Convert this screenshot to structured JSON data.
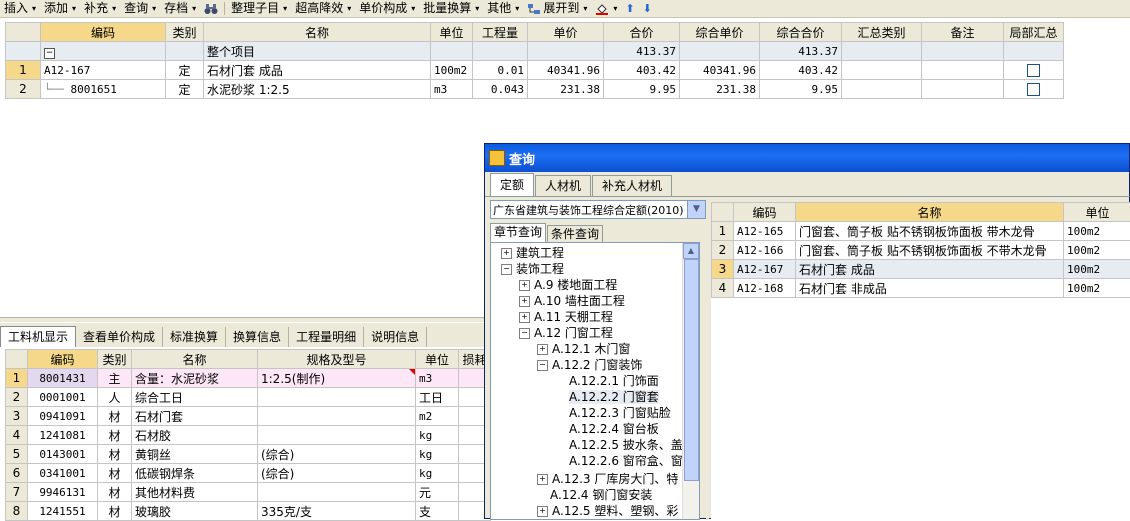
{
  "toolbar": {
    "items": [
      {
        "label": "插入"
      },
      {
        "label": "添加"
      },
      {
        "label": "补充"
      },
      {
        "label": "查询"
      },
      {
        "label": "存档"
      },
      {
        "label": "整理子目"
      },
      {
        "label": "超高降效"
      },
      {
        "label": "单价构成"
      },
      {
        "label": "批量换算"
      },
      {
        "label": "其他"
      },
      {
        "label": "展开到"
      }
    ]
  },
  "top_table": {
    "columns": [
      "编码",
      "类别",
      "名称",
      "单位",
      "工程量",
      "单价",
      "合价",
      "综合单价",
      "综合合价",
      "汇总类别",
      "备注",
      "局部汇总"
    ],
    "summary_row": {
      "expand": "−",
      "name": "整个项目",
      "total": "413.37",
      "comp_total": "413.37"
    },
    "rows": [
      {
        "num": "1",
        "code": "A12-167",
        "type": "定",
        "name": "石材门套 成品",
        "unit": "100m2",
        "qty": "0.01",
        "price": "40341.96",
        "total": "403.42",
        "comp_price": "40341.96",
        "comp_total": "403.42"
      },
      {
        "num": "2",
        "code": "8001651",
        "type": "定",
        "name": "水泥砂浆 1:2.5",
        "unit": "m3",
        "qty": "0.043",
        "price": "231.38",
        "total": "9.95",
        "comp_price": "231.38",
        "comp_total": "9.95"
      }
    ]
  },
  "bottom_tabs": [
    "工料机显示",
    "查看单价构成",
    "标准换算",
    "换算信息",
    "工程量明细",
    "说明信息"
  ],
  "bottom_table": {
    "columns": [
      "编码",
      "类别",
      "名称",
      "规格及型号",
      "单位",
      "损耗"
    ],
    "rows": [
      {
        "num": "1",
        "code": "8001431",
        "type": "主",
        "name": "含量：水泥砂浆",
        "spec": "1:2.5(制作)",
        "unit": "m3"
      },
      {
        "num": "2",
        "code": "0001001",
        "type": "人",
        "name": "综合工日",
        "spec": "",
        "unit": "工日"
      },
      {
        "num": "3",
        "code": "0941091",
        "type": "材",
        "name": "石材门套",
        "spec": "",
        "unit": "m2"
      },
      {
        "num": "4",
        "code": "1241081",
        "type": "材",
        "name": "石材胶",
        "spec": "",
        "unit": "kg"
      },
      {
        "num": "5",
        "code": "0143001",
        "type": "材",
        "name": "黄铜丝",
        "spec": "(综合)",
        "unit": "kg"
      },
      {
        "num": "6",
        "code": "0341001",
        "type": "材",
        "name": "低碳钢焊条",
        "spec": "(综合)",
        "unit": "kg"
      },
      {
        "num": "7",
        "code": "9946131",
        "type": "材",
        "name": "其他材料费",
        "spec": "",
        "unit": "元"
      },
      {
        "num": "8",
        "code": "1241551",
        "type": "材",
        "name": "玻璃胶",
        "spec": "335克/支",
        "unit": "支"
      }
    ]
  },
  "dialog": {
    "title": "查询",
    "tabs": [
      "定额",
      "人材机",
      "补充人材机"
    ],
    "quota_select": "广东省建筑与装饰工程综合定额(2010)",
    "subtabs": [
      "章节查询",
      "条件查询"
    ],
    "tree": [
      {
        "label": "建筑工程",
        "exp": "+"
      },
      {
        "label": "装饰工程",
        "exp": "−"
      },
      {
        "label": "A.9 楼地面工程",
        "exp": "+"
      },
      {
        "label": "A.10 墙柱面工程",
        "exp": "+"
      },
      {
        "label": "A.11 天棚工程",
        "exp": "+"
      },
      {
        "label": "A.12 门窗工程",
        "exp": "−"
      },
      {
        "label": "A.12.1 木门窗",
        "exp": "+"
      },
      {
        "label": "A.12.2 门窗装饰",
        "exp": "−"
      },
      {
        "label": "A.12.2.1 门饰面",
        "exp": ""
      },
      {
        "label": "A.12.2.2 门窗套",
        "exp": ""
      },
      {
        "label": "A.12.2.3 门窗贴脸",
        "exp": ""
      },
      {
        "label": "A.12.2.4 窗台板",
        "exp": ""
      },
      {
        "label": "A.12.2.5 披水条、盖",
        "exp": ""
      },
      {
        "label": "A.12.2.6 窗帘盒、窗",
        "exp": ""
      },
      {
        "label": "A.12.3 厂库房大门、特",
        "exp": "+"
      },
      {
        "label": "A.12.4 钢门窗安装",
        "exp": ""
      },
      {
        "label": "A.12.5 塑料、塑钢、彩",
        "exp": "+"
      }
    ],
    "result_columns": [
      "编码",
      "名称",
      "单位"
    ],
    "results": [
      {
        "num": "1",
        "code": "A12-165",
        "name": "门窗套、筒子板 贴不锈钢板饰面板 带木龙骨",
        "unit": "100m2"
      },
      {
        "num": "2",
        "code": "A12-166",
        "name": "门窗套、筒子板 贴不锈钢板饰面板 不带木龙骨",
        "unit": "100m2"
      },
      {
        "num": "3",
        "code": "A12-167",
        "name": "石材门套 成品",
        "unit": "100m2"
      },
      {
        "num": "4",
        "code": "A12-168",
        "name": "石材门套 非成品",
        "unit": "100m2"
      }
    ]
  },
  "colors": {
    "header_highlight": "#f5d88a",
    "selected_row": "#e7ebf2",
    "title_bar": "#0a5be0",
    "material_highlight": "#fde6f5"
  }
}
